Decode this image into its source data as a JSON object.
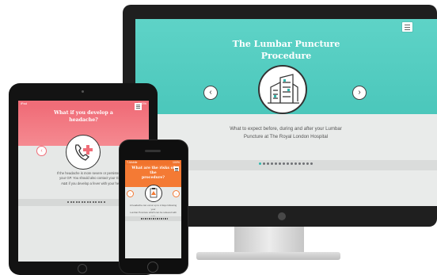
{
  "desktop": {
    "title_line1": "The Lumbar Puncture",
    "title_line2": "Procedure",
    "body_line1": "What to expect before, during and after your Lumbar",
    "body_line2": "Puncture at The Royal London Hospital",
    "prev_arrow": "‹",
    "next_arrow": "›",
    "icon": "hospital-building-icon",
    "dot_count": 14,
    "active_dot": 0,
    "accent": "#4bc7bb"
  },
  "tablet": {
    "status_left": "iPad",
    "status_right": "100%",
    "title_line1": "What if you develop a",
    "title_line2": "headache?",
    "body_line1": "If the headache is more severe or persistent, contact",
    "body_line2": "your GP. You should also contact your GP or visit",
    "body_line3": "A&E if you develop a fever with your headache",
    "prev_arrow": "‹",
    "icon": "phone-medical-icon",
    "dot_count": 14,
    "accent": "#f06d78"
  },
  "phone": {
    "status_left": "T-Mobile",
    "status_right": "100%",
    "title_line1": "What are the risks of the",
    "title_line2": "procedure?",
    "body_line1": "A headache can occur up to 2 days following your",
    "body_line2": "Lumbar Puncture which can be relieved with pain",
    "body_line3": "killers",
    "prev_arrow": "‹",
    "next_arrow": "›",
    "icon": "clipboard-warning-icon",
    "dot_count": 14,
    "accent": "#f47a34"
  }
}
